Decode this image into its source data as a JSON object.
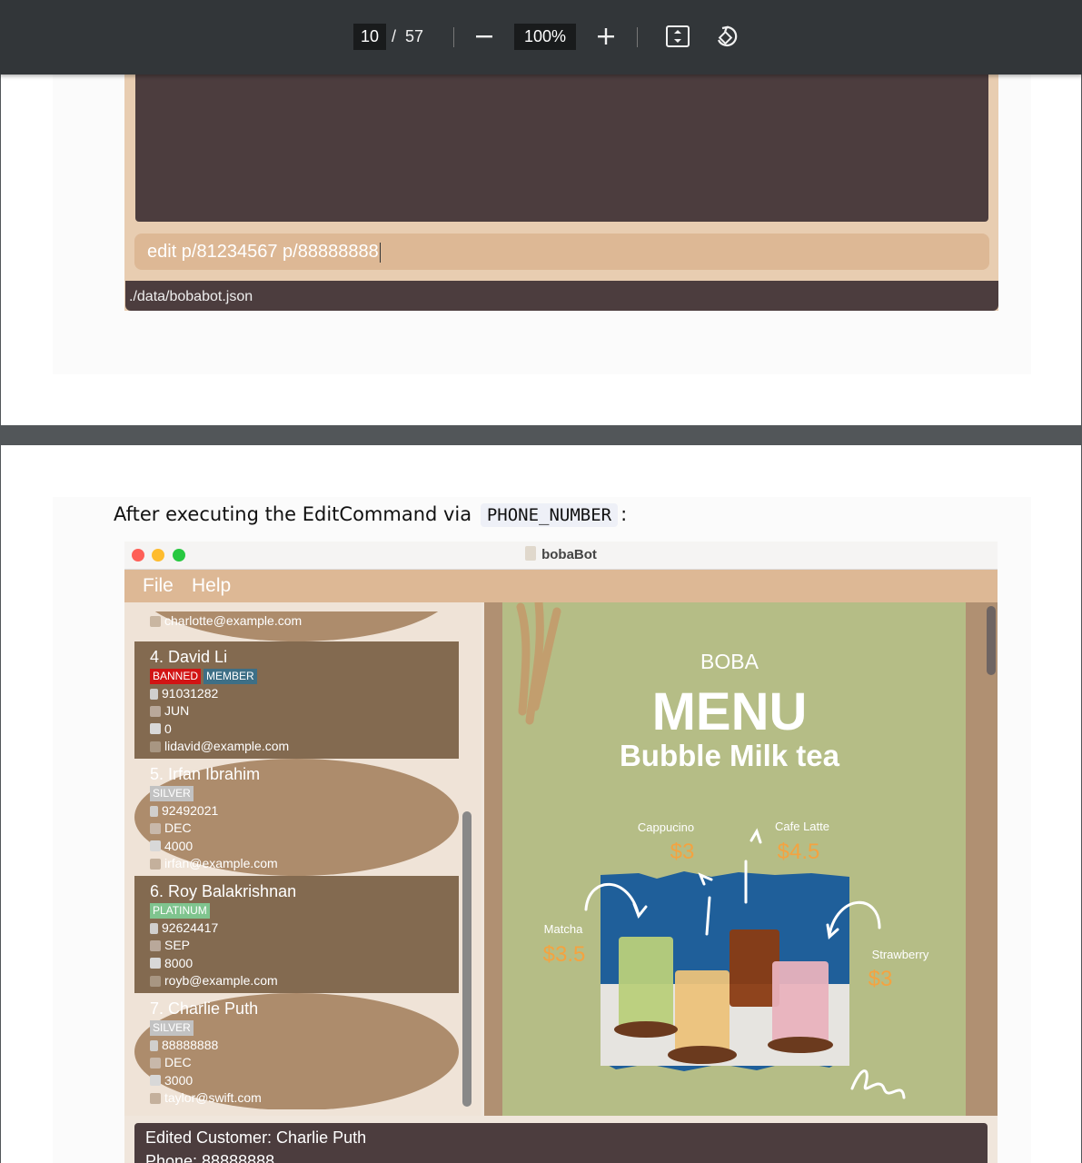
{
  "toolbar": {
    "current_page": "10",
    "separator": "/",
    "total_pages": "57",
    "zoom": "100%"
  },
  "page1": {
    "command_input": "edit p/81234567 p/88888888",
    "status_bar": "./data/bobabot.json"
  },
  "page2": {
    "text_before": "After executing the EditCommand via",
    "code": "PHONE_NUMBER",
    "text_after": ":",
    "app": {
      "title": "bobaBot",
      "menu": [
        "File",
        "Help"
      ],
      "partial_card": {
        "email": "charlotte@example.com"
      },
      "customers": [
        {
          "index": "4.",
          "name": "David Li",
          "tags": [
            {
              "label": "BANNED",
              "color": "#d21414"
            },
            {
              "label": "MEMBER",
              "color": "#3d6f86"
            }
          ],
          "phone": "91031282",
          "month": "JUN",
          "points": "0",
          "email": "lidavid@example.com"
        },
        {
          "index": "5.",
          "name": "Irfan Ibrahim",
          "tags": [
            {
              "label": "SILVER",
              "color": "#c2c2c2"
            }
          ],
          "phone": "92492021",
          "month": "DEC",
          "points": "4000",
          "email": "irfan@example.com"
        },
        {
          "index": "6.",
          "name": "Roy Balakrishnan",
          "tags": [
            {
              "label": "PLATINUM",
              "color": "#7fc48e"
            }
          ],
          "phone": "92624417",
          "month": "SEP",
          "points": "8000",
          "email": "royb@example.com"
        },
        {
          "index": "7.",
          "name": "Charlie Puth",
          "tags": [
            {
              "label": "SILVER",
              "color": "#c2c2c2"
            }
          ],
          "phone": "88888888",
          "month": "DEC",
          "points": "3000",
          "email": "taylor@swift.com"
        }
      ],
      "menu_poster": {
        "heading_small": "BOBA",
        "heading_big": "MENU",
        "subheading": "Bubble Milk tea",
        "items": [
          {
            "name": "Cappucino",
            "price": "$3"
          },
          {
            "name": "Cafe Latte",
            "price": "$4.5"
          },
          {
            "name": "Matcha",
            "price": "$3.5"
          },
          {
            "name": "Strawberry",
            "price": "$3"
          }
        ]
      },
      "result_lines": [
        "Edited Customer: Charlie Puth",
        "Phone: 88888888"
      ]
    }
  },
  "colors": {
    "toolbar_bg": "#323639",
    "app_brown": "#4c3d3e",
    "app_tan": "#ddb895",
    "poster_green": "#b5bd86",
    "price_orange": "#f4a340"
  }
}
